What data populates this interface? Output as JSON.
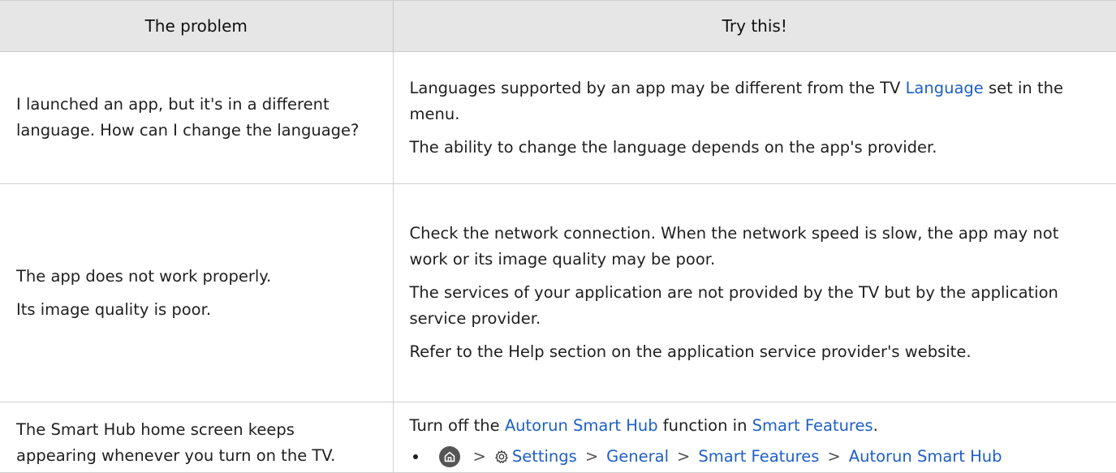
{
  "table": {
    "headers": {
      "problem": "The problem",
      "solution": "Try this!"
    },
    "rows": [
      {
        "problem": {
          "lines": [
            "I launched an app, but it's in a different language. How can I change the language?"
          ]
        },
        "solution": {
          "p1_before": "Languages supported by an app may be different from the TV ",
          "p1_link": "Language",
          "p1_after": " set in the menu.",
          "p2": "The ability to change the language depends on the app's provider."
        }
      },
      {
        "problem": {
          "lines": [
            "The app does not work properly.",
            "Its image quality is poor."
          ]
        },
        "solution": {
          "paragraphs": [
            "Check the network connection. When the network speed is slow, the app may not work or its image quality may be poor.",
            "The services of your application are not provided by the TV but by the application service provider.",
            "Refer to the Help section on the application service provider's website."
          ]
        }
      },
      {
        "problem": {
          "lines": [
            "The Smart Hub home screen keeps appearing whenever you turn on the TV."
          ]
        },
        "solution": {
          "p1_before": "Turn off the ",
          "p1_link1": "Autorun Smart Hub",
          "p1_middle": " function in ",
          "p1_link2": "Smart Features",
          "p1_after": ".",
          "path": {
            "separator": ">",
            "items": [
              "Settings",
              "General",
              "Smart Features",
              "Autorun Smart Hub"
            ],
            "home_icon": "home-icon",
            "settings_icon": "gear-icon"
          }
        }
      }
    ]
  },
  "colors": {
    "header_bg": "#e6e6e6",
    "link": "#1e5fc8",
    "border": "#cfcfcf",
    "text": "#1f1f1f"
  }
}
